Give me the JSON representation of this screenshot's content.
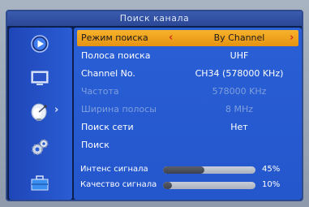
{
  "title": "Поиск канала",
  "sidebar": {
    "items": [
      {
        "icon": "play-icon"
      },
      {
        "icon": "tv-icon"
      },
      {
        "icon": "satellite-dish-icon",
        "active": true
      },
      {
        "icon": "gears-icon"
      },
      {
        "icon": "toolbox-icon"
      }
    ]
  },
  "menu": {
    "rows": [
      {
        "label": "Режим поиска",
        "value": "By Channel"
      },
      {
        "label": "Полоса поиска",
        "value": "UHF"
      },
      {
        "label": "Channel No.",
        "value": "CH34 (578000 KHz)"
      },
      {
        "label": "Частота",
        "value": "578000 KHz"
      },
      {
        "label": "Ширина полосы",
        "value": "8 MHz"
      },
      {
        "label": "Поиск сети",
        "value": "Нет"
      },
      {
        "label": "Поиск",
        "value": ""
      }
    ]
  },
  "signal": {
    "intensity_label": "Интенс сигнала",
    "intensity_pct": "45%",
    "intensity_level": 0.45,
    "quality_label": "Качество сигнала",
    "quality_pct": "10%",
    "quality_level": 0.1
  },
  "colors": {
    "selected_row": "#f7b22b",
    "panel": "#2a5fd6",
    "arrow": "#d12f1d"
  }
}
